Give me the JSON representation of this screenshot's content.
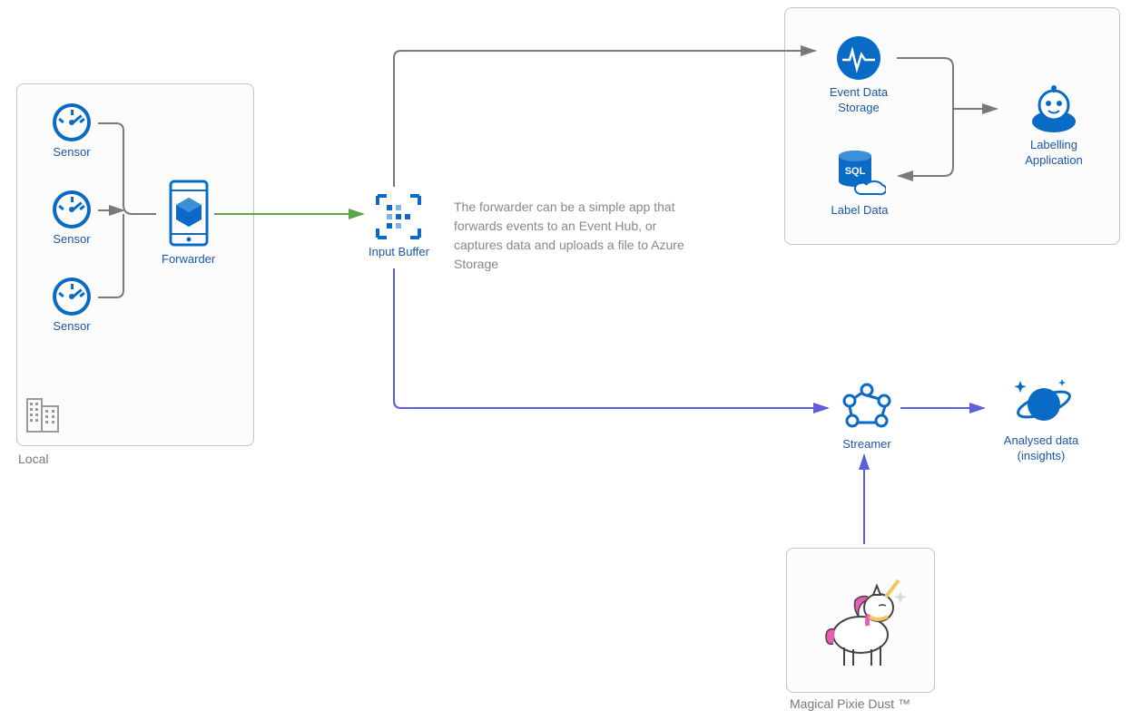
{
  "groups": {
    "local": {
      "label": "Local"
    },
    "cloud": {
      "label": ""
    },
    "pixie": {
      "label": "Magical Pixie Dust ™"
    }
  },
  "nodes": {
    "sensor1": {
      "label": "Sensor"
    },
    "sensor2": {
      "label": "Sensor"
    },
    "sensor3": {
      "label": "Sensor"
    },
    "forwarder": {
      "label": "Forwarder"
    },
    "inputBuffer": {
      "label": "Input Buffer"
    },
    "eventData": {
      "label": "Event Data Storage"
    },
    "labelData": {
      "label": "Label Data"
    },
    "labelling": {
      "label": "Labelling Application"
    },
    "streamer": {
      "label": "Streamer"
    },
    "analysed": {
      "label": "Analysed data (insights)"
    }
  },
  "description": "The forwarder can be a simple app that forwards events to an Event Hub, or captures data and uploads a file to Azure Storage",
  "colors": {
    "azureBlue": "#0a6bc7",
    "purple": "#5d5ed9",
    "green": "#5aa844",
    "gray": "#7a7a7a"
  }
}
